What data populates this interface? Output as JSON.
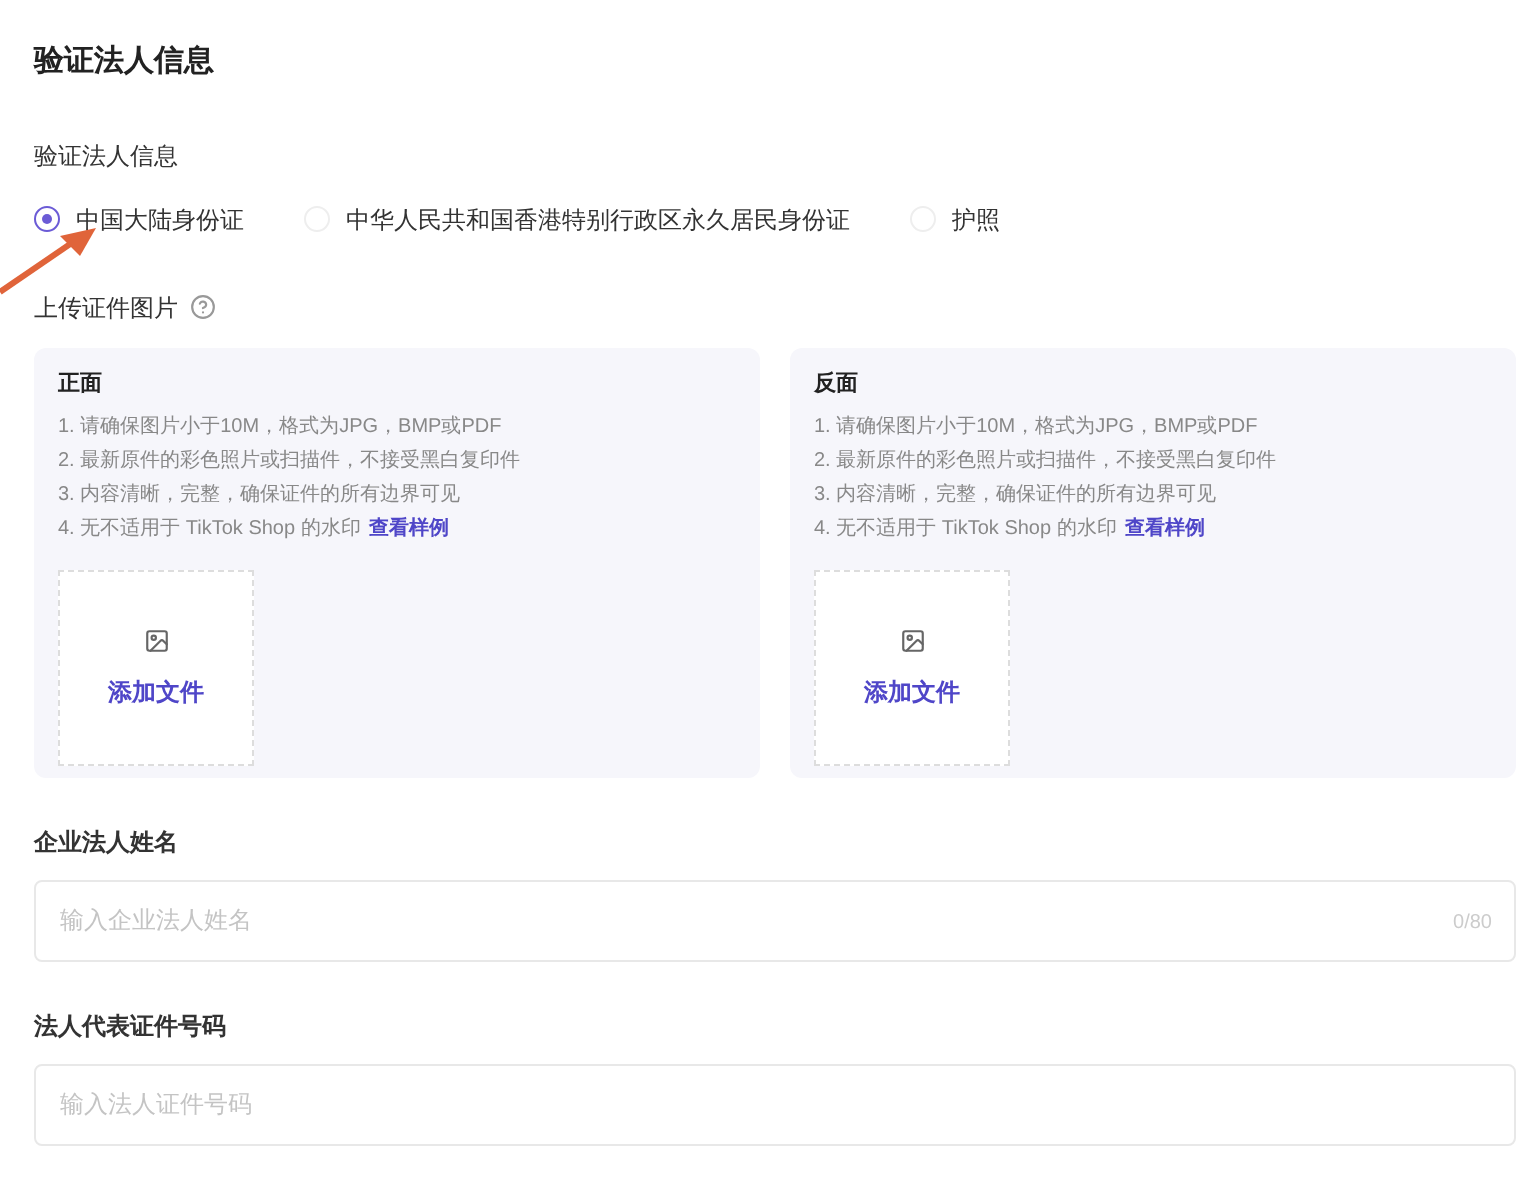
{
  "title": "验证法人信息",
  "id_type": {
    "label": "验证法人信息",
    "options": [
      {
        "label": "中国大陆身份证",
        "selected": true
      },
      {
        "label": "中华人民共和国香港特别行政区永久居民身份证",
        "selected": false
      },
      {
        "label": "护照",
        "selected": false
      }
    ]
  },
  "upload": {
    "label": "上传证件图片",
    "cards": [
      {
        "title": "正面",
        "rules": [
          "1. 请确保图片小于10M，格式为JPG，BMP或PDF",
          "2. 最新原件的彩色照片或扫描件，不接受黑白复印件",
          "3. 内容清晰，完整，确保证件的所有边界可见"
        ],
        "last_rule": "4. 无不适用于 TikTok Shop 的水印",
        "link": "查看样例",
        "add": "添加文件"
      },
      {
        "title": "反面",
        "rules": [
          "1. 请确保图片小于10M，格式为JPG，BMP或PDF",
          "2. 最新原件的彩色照片或扫描件，不接受黑白复印件",
          "3. 内容清晰，完整，确保证件的所有边界可见"
        ],
        "last_rule": "4. 无不适用于 TikTok Shop 的水印",
        "link": "查看样例",
        "add": "添加文件"
      }
    ]
  },
  "fields": [
    {
      "label": "企业法人姓名",
      "placeholder": "输入企业法人姓名",
      "counter": "0/80"
    },
    {
      "label": "法人代表证件号码",
      "placeholder": "输入法人证件号码"
    }
  ]
}
